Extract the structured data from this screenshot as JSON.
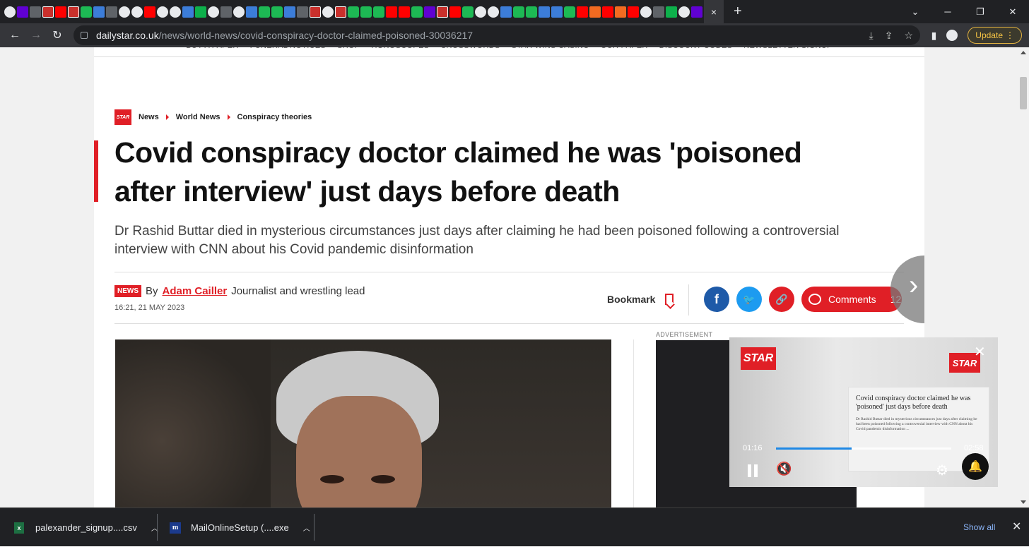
{
  "browser": {
    "tab_icons": [
      "chrome-icon",
      "yahoo-icon",
      "wapo-icon",
      "bi-icon",
      "youtube-icon",
      "bi-icon",
      "play-icon",
      "shield-icon",
      "docs-icon",
      "puzzle-icon",
      "globe-icon",
      "youtube-icon",
      "globe-icon",
      "globe-icon",
      "search-icon",
      "maps-icon",
      "google-icon",
      "wapo-icon",
      "globe-icon",
      "shield-icon",
      "play-icon",
      "play-icon",
      "search-icon",
      "docs-icon",
      "bi-icon",
      "globe-icon",
      "bi-icon",
      "play-icon",
      "play-icon",
      "play-icon",
      "youtube-icon",
      "youtube-icon",
      "play-icon",
      "yahoo-icon",
      "bi-icon",
      "youtube-icon",
      "play-icon",
      "globe-icon",
      "globe-icon",
      "search-icon",
      "play-icon",
      "play-icon",
      "shield-icon",
      "search-icon",
      "play-icon",
      "youtube-icon",
      "orange-icon",
      "red-icon",
      "orange-icon",
      "red-icon",
      "google-icon",
      "dark-icon",
      "green-icon",
      "globe-icon",
      "yahoo-icon"
    ],
    "active_tab_close": "×",
    "new_tab": "+",
    "url_host": "dailystar.co.uk",
    "url_path": "/news/world-news/covid-conspiracy-doctor-claimed-poisoned-30036217",
    "update_label": "Update"
  },
  "page": {
    "topnav": [
      "BUY A PAPER",
      "FUNERAL NOTICES",
      "SHOP",
      "HOROSCOPES",
      "CROSSWORDS",
      "STAR WINS CASINO",
      "OUR PAPER",
      "DISCOUNT CODES",
      "NEWSLETTER SIGNUP"
    ],
    "logo_text": "STAR",
    "breadcrumbs": [
      "News",
      "World News",
      "Conspiracy theories"
    ],
    "headline": "Covid conspiracy doctor claimed he was 'poisoned after interview' just days before death",
    "standfirst": "Dr Rashid Buttar died in mysterious circumstances just days after claiming he had been poisoned following a controversial interview with CNN about his Covid pandemic disinformation",
    "badge": "NEWS",
    "by": "By",
    "author": "Adam Cailler",
    "author_role": "Journalist and wrestling lead",
    "timestamp": "16:21, 21 MAY 2023",
    "bookmark_label": "Bookmark",
    "comments_label": "Comments",
    "comments_count": "12",
    "ad_label": "ADVERTISEMENT"
  },
  "video": {
    "logo_left": "STAR",
    "logo_right": "STAR",
    "card_title": "Covid conspiracy doctor claimed he was 'poisoned' just days before death",
    "card_body": "Dr Rashid Buttar died in mysterious circumstances just days after claiming he had been poisoned following a controversial interview with CNN about his Covid pandemic disinformation ...",
    "current_time": "01:16",
    "duration": "02:58",
    "progress_fraction": 0.43
  },
  "downloads": {
    "items": [
      {
        "name": "palexander_signup....csv"
      },
      {
        "name": "MailOnlineSetup (....exe"
      }
    ],
    "show_all": "Show all"
  },
  "colors": {
    "brand_red": "#e01f26",
    "facebook": "#1e5aa8",
    "twitter": "#1d9bf0",
    "progress": "#1e88e5"
  }
}
